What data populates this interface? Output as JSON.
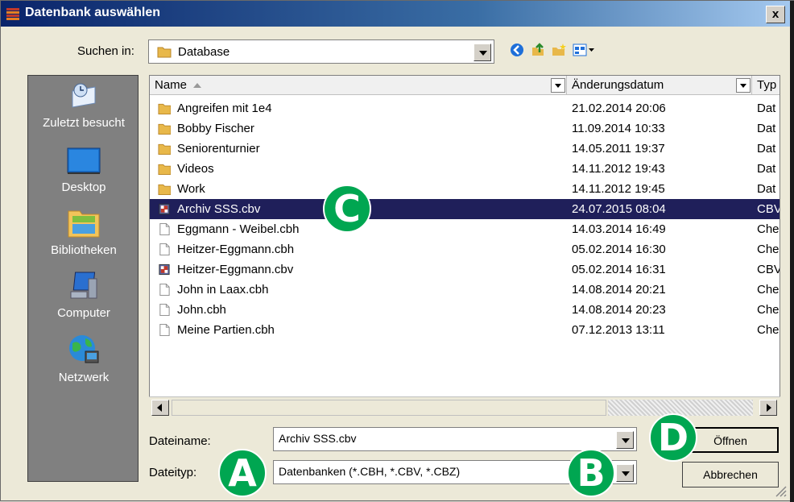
{
  "window": {
    "title": "Datenbank auswählen",
    "close_label": "x"
  },
  "toolbar": {
    "lookin_label": "Suchen in:",
    "lookin_value": "Database",
    "icons": [
      "back-icon",
      "up-folder-icon",
      "new-folder-icon",
      "view-menu-icon"
    ]
  },
  "places": [
    {
      "label": "Zuletzt besucht",
      "icon": "recent-places-icon"
    },
    {
      "label": "Desktop",
      "icon": "desktop-icon"
    },
    {
      "label": "Bibliotheken",
      "icon": "libraries-icon"
    },
    {
      "label": "Computer",
      "icon": "computer-icon"
    },
    {
      "label": "Netzwerk",
      "icon": "network-icon"
    }
  ],
  "columns": {
    "name": "Name",
    "date": "Änderungsdatum",
    "type": "Typ"
  },
  "files": [
    {
      "name": "Angreifen mit 1e4",
      "date": "21.02.2014 20:06",
      "type": "Dat",
      "icon": "folder-icon"
    },
    {
      "name": "Bobby Fischer",
      "date": "11.09.2014 10:33",
      "type": "Dat",
      "icon": "folder-icon"
    },
    {
      "name": "Seniorenturnier",
      "date": "14.05.2011 19:37",
      "type": "Dat",
      "icon": "folder-icon"
    },
    {
      "name": "Videos",
      "date": "14.11.2012 19:43",
      "type": "Dat",
      "icon": "folder-icon"
    },
    {
      "name": "Work",
      "date": "14.11.2012 19:45",
      "type": "Dat",
      "icon": "folder-icon"
    },
    {
      "name": "Archiv SSS.cbv",
      "date": "24.07.2015 08:04",
      "type": "CBV",
      "icon": "cbv-archive-icon",
      "selected": true
    },
    {
      "name": "Eggmann - Weibel.cbh",
      "date": "14.03.2014 16:49",
      "type": "Che",
      "icon": "document-icon"
    },
    {
      "name": "Heitzer-Eggmann.cbh",
      "date": "05.02.2014 16:30",
      "type": "Che",
      "icon": "document-icon"
    },
    {
      "name": "Heitzer-Eggmann.cbv",
      "date": "05.02.2014 16:31",
      "type": "CBV",
      "icon": "cbv-archive-icon"
    },
    {
      "name": "John in Laax.cbh",
      "date": "14.08.2014 20:21",
      "type": "Che",
      "icon": "document-icon"
    },
    {
      "name": "John.cbh",
      "date": "14.08.2014 20:23",
      "type": "Che",
      "icon": "document-icon"
    },
    {
      "name": "Meine Partien.cbh",
      "date": "07.12.2013 13:11",
      "type": "Che",
      "icon": "document-icon"
    }
  ],
  "filename": {
    "label": "Dateiname:",
    "value": "Archiv SSS.cbv"
  },
  "filetype": {
    "label": "Dateityp:",
    "value": "Datenbanken (*.CBH, *.CBV, *.CBZ)"
  },
  "buttons": {
    "open": "Öffnen",
    "cancel": "Abbrechen"
  },
  "annotations": {
    "a": "A",
    "b": "B",
    "c": "C",
    "d": "D",
    "color": "#00a651"
  },
  "colors": {
    "selection": "#1f1f5a",
    "title_gradient_start": "#0a246a",
    "places_bg": "#808080"
  }
}
